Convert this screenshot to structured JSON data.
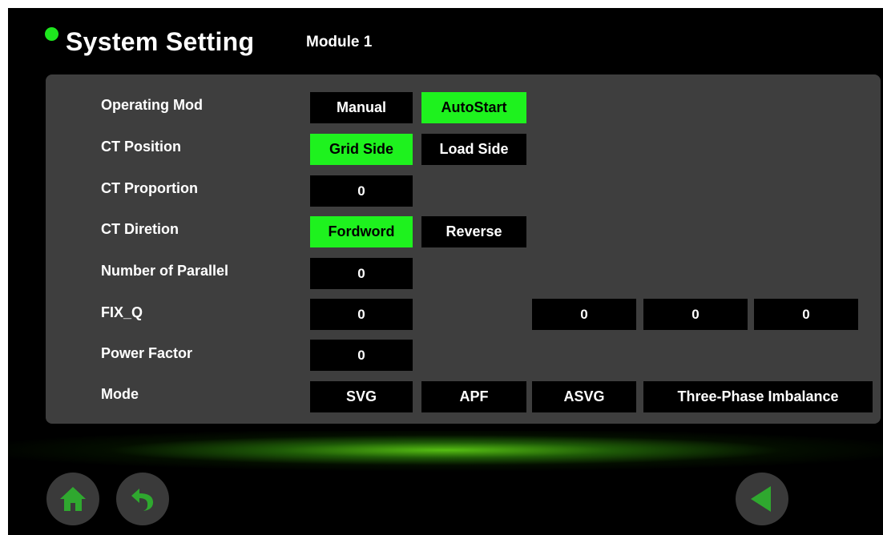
{
  "header": {
    "title": "System Setting",
    "module": "Module 1",
    "status_color": "#1ee61e"
  },
  "rows": {
    "operating_mode": {
      "label": "Operating Mod",
      "options": [
        "Manual",
        "AutoStart"
      ],
      "selected": "AutoStart"
    },
    "ct_position": {
      "label": "CT Position",
      "options": [
        "Grid Side",
        "Load Side"
      ],
      "selected": "Grid Side"
    },
    "ct_proportion": {
      "label": "CT Proportion",
      "value": "0"
    },
    "ct_direction": {
      "label": "CT Diretion",
      "options": [
        "Fordword",
        "Reverse"
      ],
      "selected": "Fordword"
    },
    "number_of_parallel": {
      "label": "Number of Parallel",
      "value": "0"
    },
    "fix_q": {
      "label": "FIX_Q",
      "values": [
        "0",
        "0",
        "0",
        "0"
      ]
    },
    "power_factor": {
      "label": "Power Factor",
      "value": "0"
    },
    "mode": {
      "label": "Mode",
      "options": [
        "SVG",
        "APF",
        "ASVG",
        "Three-Phase Imbalance"
      ]
    }
  },
  "colors": {
    "active": "#1ef21e",
    "inactive": "#000000",
    "panel": "#3e3e3e",
    "nav_icon": "#2fa82f"
  },
  "nav": {
    "home_icon": "home-icon",
    "back_icon": "undo-arrow-icon",
    "prev_icon": "triangle-left-icon"
  }
}
